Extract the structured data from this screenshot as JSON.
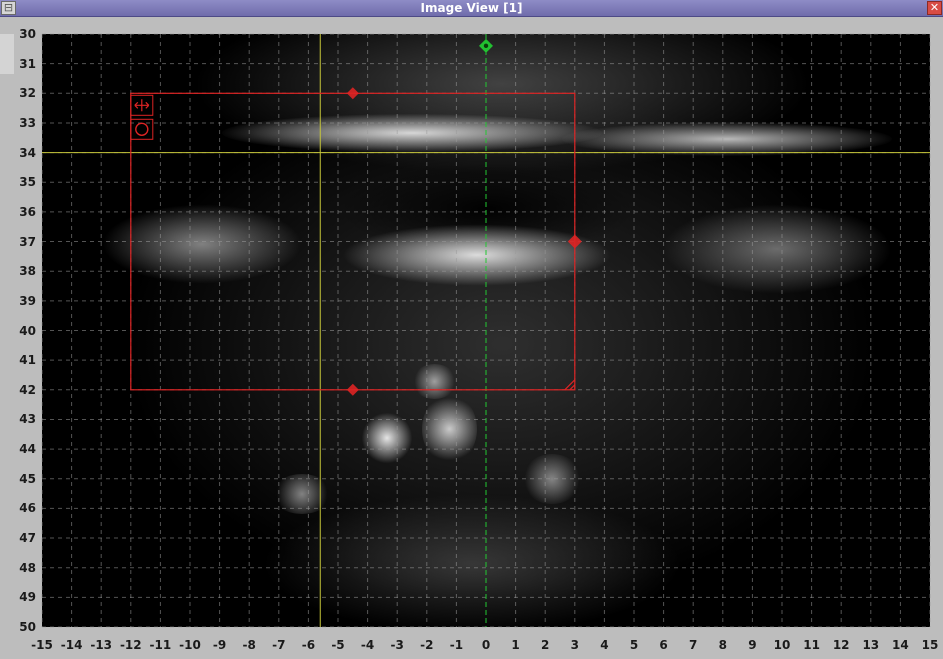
{
  "window": {
    "title": "Image View [1]",
    "minimize_symbol": "⊟",
    "close_symbol": "✕",
    "side_tab_symbol": "▶"
  },
  "axes": {
    "y_ticks": [
      "30",
      "31",
      "32",
      "33",
      "34",
      "35",
      "36",
      "37",
      "38",
      "39",
      "40",
      "41",
      "42",
      "43",
      "44",
      "45",
      "46",
      "47",
      "48",
      "49",
      "50"
    ],
    "x_ticks": [
      "-15",
      "-14",
      "-13",
      "-12",
      "-11",
      "-10",
      "-9",
      "-8",
      "-7",
      "-6",
      "-5",
      "-4",
      "-3",
      "-2",
      "-1",
      "0",
      "1",
      "2",
      "3",
      "4",
      "5",
      "6",
      "7",
      "8",
      "9",
      "10",
      "11",
      "12",
      "13",
      "14",
      "15"
    ],
    "x_range": [
      -15,
      15
    ],
    "y_range": [
      30,
      50
    ],
    "grid": true
  },
  "cursor": {
    "x": -5.6,
    "y": 34
  },
  "roi": {
    "x_min": -12,
    "x_max": 3,
    "y_min": 32,
    "y_max": 42
  },
  "colors": {
    "roi": "#dd2424",
    "crosshair": "#c8c83a",
    "center_line": "#22c832",
    "grid": "#9a9a9a"
  }
}
